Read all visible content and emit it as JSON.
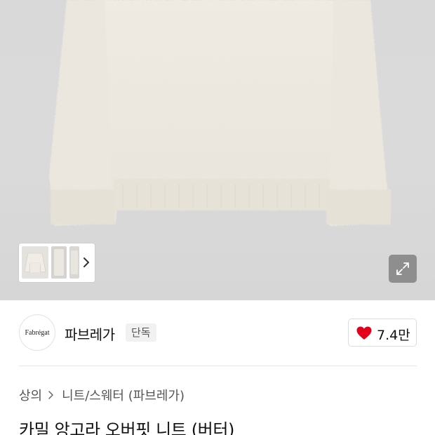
{
  "product": {
    "image_alt": "sweater-image",
    "thumbnails": [
      "thumb-1",
      "thumb-2",
      "thumb-3"
    ],
    "brand": {
      "logo_text": "Fabrégat",
      "name": "파브레가",
      "badge": "단독"
    },
    "likes": {
      "count": "7.4만",
      "icon": "heart-icon",
      "icon_color": "#e3001b"
    },
    "breadcrumb": {
      "category": "상의",
      "subcategory": "니트/스웨터 (파브레가)"
    },
    "title": "카밀 앙고라 오버핏 니트 (버터)"
  },
  "icons": {
    "expand": "expand-icon",
    "thumb_next": "chevron-right-icon",
    "breadcrumb_separator": "chevron-right-icon"
  }
}
